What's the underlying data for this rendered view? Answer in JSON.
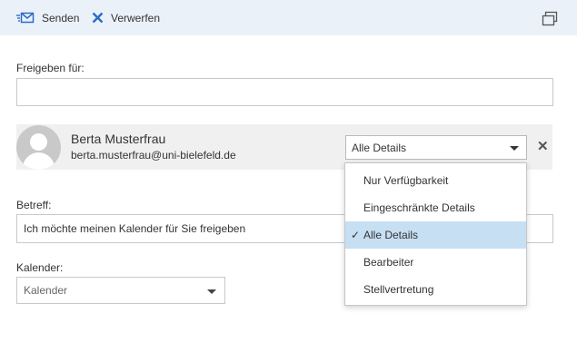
{
  "toolbar": {
    "send_label": "Senden",
    "discard_label": "Verwerfen",
    "accent_color": "#2b6cc4"
  },
  "share_with": {
    "label": "Freigeben für:",
    "value": ""
  },
  "recipient": {
    "name": "Berta Musterfrau",
    "email": "berta.musterfrau@uni-bielefeld.de",
    "permission": "Alle Details",
    "remove_icon": "close-icon"
  },
  "subject": {
    "label": "Betreff:",
    "value": "Ich möchte meinen Kalender für Sie freigeben"
  },
  "calendar": {
    "label": "Kalender:",
    "placeholder": "Kalender"
  },
  "permission_options": [
    {
      "label": "Nur Verfügbarkeit",
      "selected": false
    },
    {
      "label": "Eingeschränkte Details",
      "selected": false
    },
    {
      "label": "Alle Details",
      "selected": true
    },
    {
      "label": "Bearbeiter",
      "selected": false
    },
    {
      "label": "Stellvertretung",
      "selected": false
    }
  ],
  "selected_check": "✓",
  "selected_color": "#c7dff3"
}
